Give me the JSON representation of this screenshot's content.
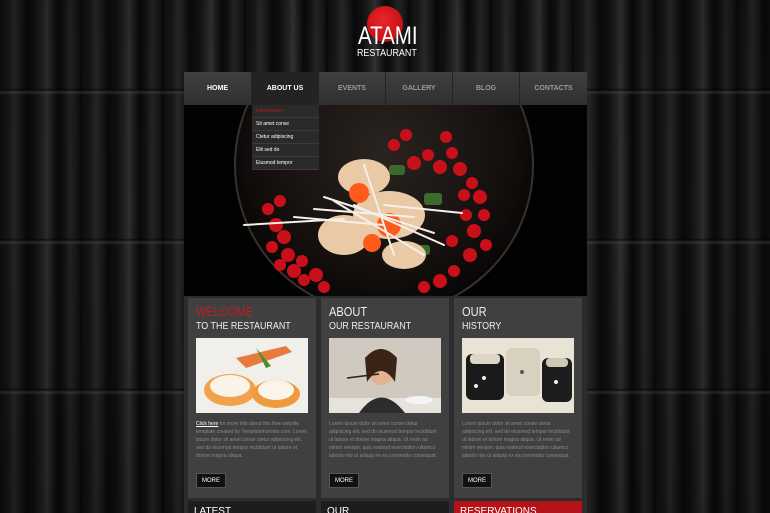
{
  "logo": {
    "title": "ATAMI",
    "subtitle": "RESTAURANT"
  },
  "nav": {
    "items": [
      {
        "label": "HOME"
      },
      {
        "label": "ABOUT US"
      },
      {
        "label": "EVENTS"
      },
      {
        "label": "GALLERY"
      },
      {
        "label": "BLOG"
      },
      {
        "label": "CONTACTS"
      }
    ],
    "dropdown": [
      "Loremipsum",
      "Sit amet conse",
      "Ctetur adipiscing",
      "Elit sed do",
      "Eiusmod tempor"
    ]
  },
  "columns": [
    {
      "title": "WELCOME",
      "subtitle": "TO THE RESTAURANT",
      "link": "Click here",
      "text": "for more info about this free website template created by Templatemonster.com. Lorem ipsum dolor sit amet conse ctetur adipiscing elit, sed do eiusmod tempor incididunt ut labore et dolore magna aliqua.",
      "more": "MORE"
    },
    {
      "title": "ABOUT",
      "subtitle": "OUR RESTAURANT",
      "text": "Lorem ipsum dolor sit amet conse ctetur adipiscing elit, sed do eiusmod tempor incididunt ut labore et dolore magna aliqua. Ut enim ad minim veniam, quis nostrud exercitation ullamco laboris nisi ut aliquip ex ea commodo consequat.",
      "more": "MORE"
    },
    {
      "title": "OUR",
      "subtitle": "HISTORY",
      "text": "Lorem ipsum dolor sit amet conse ctetur adipiscing elit, sed do eiusmod tempor incididunt ut labore et dolore magna aliqua. Ut enim ad minim veniam, quis nostrud exercitation ullamco laboris nisi ut aliquip ex ea commodo consequat.",
      "more": "MORE"
    }
  ],
  "bottom": {
    "left": "LATEST",
    "middle": "OUR",
    "right": "RESERVATIONS"
  },
  "colors": {
    "accent": "#c41b1f",
    "panel": "#2c2c2c"
  }
}
